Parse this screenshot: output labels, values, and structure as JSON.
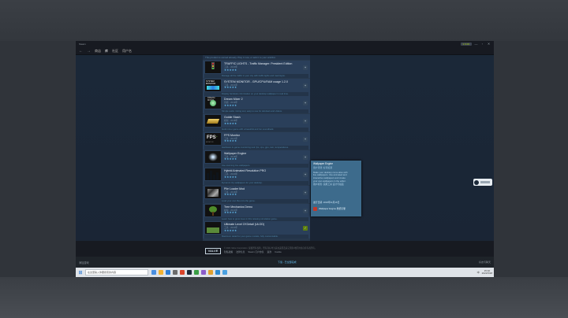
{
  "window": {
    "title_left": "Steam",
    "title_right_pill": "¥ 0.00",
    "controls": [
      "—",
      "▫",
      "✕"
    ]
  },
  "nav": {
    "back": "←",
    "forward": "→",
    "tabs": [
      "商店",
      "库",
      "社区",
      "用户名"
    ],
    "active_tab": 1
  },
  "list": {
    "first_note": "This product is owned already. Play it now, or add it to your wishlist.",
    "items": [
      {
        "name": "TRAFFIC LIGHTS - Traffic Manager: President Edition",
        "meta": "工具 · 2020年",
        "stars": "★★★★★",
        "desc": "Manage all the traffic in your city with traffic lights and road signs.",
        "btn": "+",
        "thumb": "traffic"
      },
      {
        "name": "SYSTEM MONITOR - GPU/CPU/RAM usage 1.2.0",
        "meta": "工具 · 2021年",
        "stars": "★★★★★",
        "desc": "Display hardware information on your desktop wallpaper in real time.",
        "btn": "+",
        "thumb": "sysmon",
        "thumb_label": "SYSTEM MONITOR"
      },
      {
        "name": "Dream Mixer 2",
        "meta": "音频 · 2019年",
        "stars": "★★★★★",
        "desc": "Simple audio mixing tool, easy to use for windows and videos.",
        "btn": "+",
        "thumb": "orb",
        "thumb_label": "DREAM MIXER"
      },
      {
        "name": "Goldie Stash",
        "meta": "模拟 · 2018年",
        "stars": "★★★★★",
        "desc": "Gold miner game with a beautiful and fun soundtrack.",
        "btn": "+",
        "thumb": "gold"
      },
      {
        "name": "FPS Monitor",
        "meta": "工具 · 2017年",
        "stars": "★★★★★",
        "desc": "Hardware in-game monitoring tool: fps, cpu, gpu, ram, temperatures.",
        "btn": "+",
        "thumb": "fps",
        "thumb_label": "FPS",
        "thumb_sub": "MONITOR"
      },
      {
        "name": "Wallpaper Engine",
        "meta": "工具 · 2018年",
        "stars": "★★★★★",
        "desc": "Use stunning live wallpapers.",
        "btn": "+",
        "thumb": "wall"
      },
      {
        "name": "Hybrid Animated Resolution PRO",
        "meta": "工具 · 2020年",
        "stars": "★★★★★",
        "desc": "Dynamic city wallpapers for your desktop.",
        "btn": "+",
        "thumb": "city"
      },
      {
        "name": "Pile Loader Mod",
        "meta": "工具 · 2016年",
        "stars": "★★★★★",
        "desc": "Load your own files into the game.",
        "btn": "+",
        "thumb": "pile"
      },
      {
        "name": "Tree Mechanics Demo",
        "meta": "模拟 · 2021年",
        "stars": "★★★★★",
        "desc": "Learn how to grow trees in this relaxing simulation game.",
        "btn": "+",
        "thumb": "tree"
      },
      {
        "name": "Ultimate Level Of Detail (ULOD)",
        "meta": "工具 · 2020年",
        "stars": "★★★★★",
        "desc": "Maximum detail for your game models, fully customisable.",
        "btn": "✓",
        "btn_green": true,
        "thumb": "cloud"
      }
    ]
  },
  "tooltip": {
    "title": "Wallpaper Engine",
    "sub": "用户评测: 好评如潮",
    "lines": [
      "Make your desktop come alive with",
      "live wallpapers. Use animated and",
      "interactive wallpapers and create",
      "your own wallpapers in the editor.",
      "",
      "用户标签: 实用工具 设计与插画"
    ],
    "foot": "发行日期: 2018年11月16日",
    "app_label": "Wallpaper Engine 壁纸引擎"
  },
  "footer": {
    "logo": "VALVE",
    "legal": "© 2021 Valve Corporation. 保留所有权利。所有商标均为其在美国及其它国家/地区的各自持有者所有。",
    "links": [
      "隐私政策",
      "法律信息",
      "Steam 订户协议",
      "退款",
      "Cookie"
    ]
  },
  "status": {
    "left": "添加游戏",
    "center": "下载 - 已全部完成",
    "right": "好友与聊天"
  },
  "taskbar": {
    "search_placeholder": "在这里输入你要搜索的内容",
    "time": "15:32",
    "date": "2021/5/18",
    "lang": "中",
    "icon_colors": [
      "#4a8fe0",
      "#f2b233",
      "#2f7fd6",
      "#6b6b6b",
      "#d9442b",
      "#1b2838",
      "#3a9d45",
      "#8b5cc9",
      "#e0a030",
      "#2f8ad0",
      "#4aa0e0"
    ]
  },
  "colors": {
    "steam_bg": "#1b2838",
    "panel": "#27384c",
    "accent": "#66c0f4",
    "green_btn": "#5c7e10"
  }
}
